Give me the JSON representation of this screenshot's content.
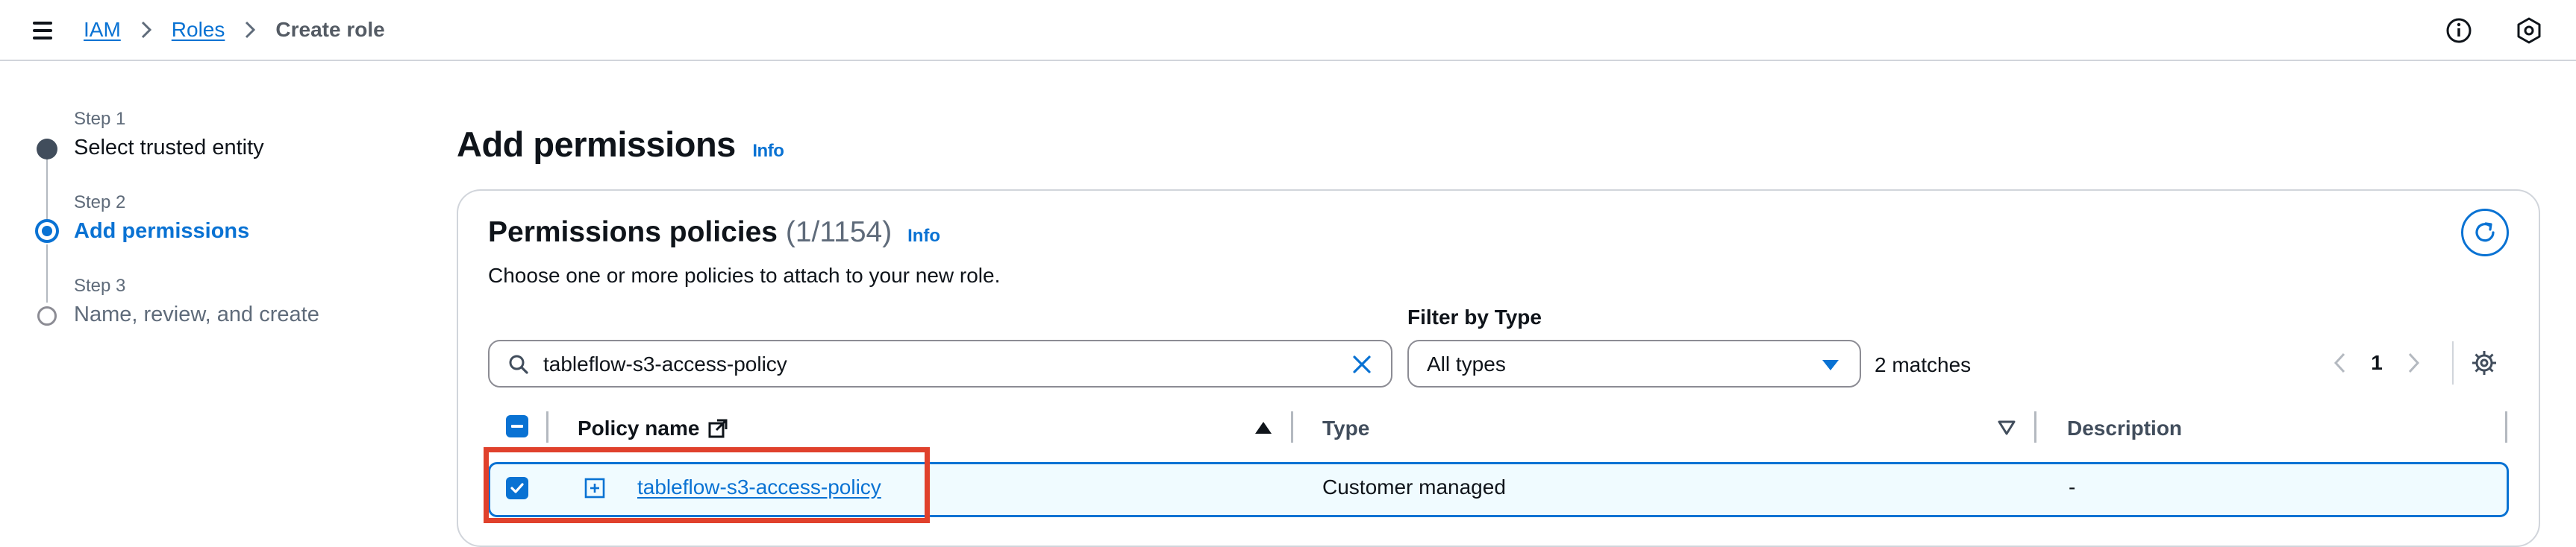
{
  "breadcrumb": {
    "items": [
      {
        "label": "IAM"
      },
      {
        "label": "Roles"
      }
    ],
    "current": "Create role"
  },
  "header": {
    "menu_icon": "hamburger-menu-icon",
    "info_icon": "info-circle-icon",
    "settings_icon": "hexagon-settings-icon"
  },
  "wizard": {
    "steps": [
      {
        "label": "Step 1",
        "title": "Select trusted entity",
        "state": "completed"
      },
      {
        "label": "Step 2",
        "title": "Add permissions",
        "state": "active"
      },
      {
        "label": "Step 3",
        "title": "Name, review, and create",
        "state": "pending"
      }
    ]
  },
  "page": {
    "title": "Add permissions",
    "info_label": "Info"
  },
  "policies_panel": {
    "title": "Permissions policies",
    "count": "(1/1154)",
    "info_label": "Info",
    "description": "Choose one or more policies to attach to your new role.",
    "search_value": "tableflow-s3-access-policy",
    "filter_label": "Filter by Type",
    "filter_value": "All types",
    "matches": "2 matches",
    "current_page": "1"
  },
  "table": {
    "columns": [
      {
        "label": "Policy name",
        "sort": "ascending"
      },
      {
        "label": "Type",
        "sort": "none"
      },
      {
        "label": "Description",
        "sort": "none"
      }
    ],
    "rows": [
      {
        "selected": true,
        "policy_name": "tableflow-s3-access-policy",
        "type": "Customer managed",
        "description": "-"
      }
    ]
  },
  "colors": {
    "accent": "#0972d3",
    "text": "#0f141a",
    "muted": "#5f6b7a",
    "highlight_border": "#e0412c",
    "selected_row_bg": "#f0fbff"
  }
}
